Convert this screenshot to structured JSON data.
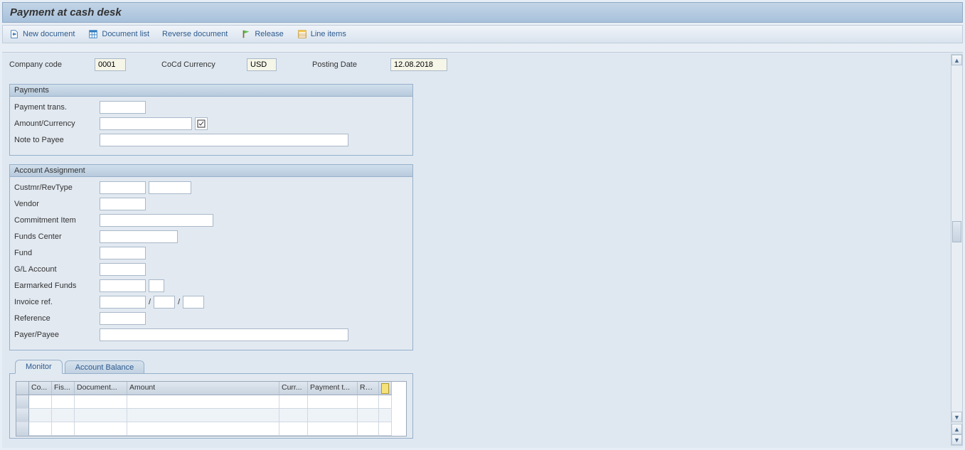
{
  "title": "Payment at cash desk",
  "toolbar": {
    "new_document": "New document",
    "document_list": "Document list",
    "reverse_document": "Reverse document",
    "release": "Release",
    "line_items": "Line items"
  },
  "header": {
    "company_code_label": "Company code",
    "company_code_value": "0001",
    "cocd_currency_label": "CoCd Currency",
    "cocd_currency_value": "USD",
    "posting_date_label": "Posting Date",
    "posting_date_value": "12.08.2018"
  },
  "payments": {
    "title": "Payments",
    "payment_trans_label": "Payment trans.",
    "amount_currency_label": "Amount/Currency",
    "note_to_payee_label": "Note to Payee"
  },
  "account_assignment": {
    "title": "Account Assignment",
    "custmr_revtype_label": "Custmr/RevType",
    "vendor_label": "Vendor",
    "commitment_item_label": "Commitment Item",
    "funds_center_label": "Funds Center",
    "fund_label": "Fund",
    "gl_account_label": "G/L Account",
    "earmarked_funds_label": "Earmarked Funds",
    "invoice_ref_label": "Invoice ref.",
    "reference_label": "Reference",
    "payer_payee_label": "Payer/Payee",
    "sep": "/"
  },
  "tabs": {
    "monitor": "Monitor",
    "account_balance": "Account Balance"
  },
  "grid": {
    "columns": {
      "co": "Co...",
      "fis": "Fis...",
      "document": "Document...",
      "amount": "Amount",
      "curr": "Curr...",
      "payment_t": "Payment t...",
      "reve": "Reve"
    }
  }
}
